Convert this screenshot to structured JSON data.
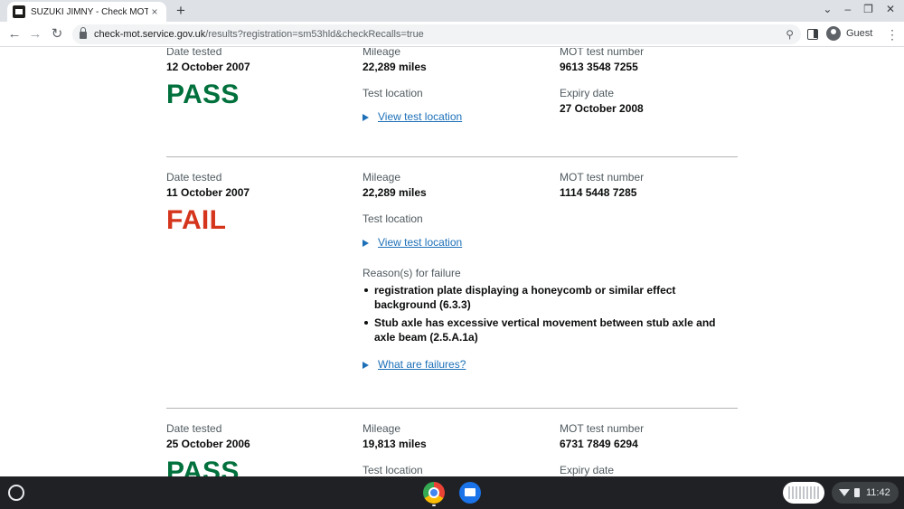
{
  "browser": {
    "tab": {
      "title": "SUZUKI JIMNY - Check MOT history",
      "close": "×"
    },
    "new_tab": "+",
    "window_controls": [
      "⌄",
      "–",
      "❐",
      "✕"
    ],
    "nav": {
      "back": "←",
      "forward": "→",
      "reload": "↻"
    },
    "url": {
      "host": "check-mot.service.gov.uk",
      "path": "/results?registration=sm53hld&checkRecalls=true"
    },
    "zoom": "⚲",
    "profile_label": "Guest",
    "menu": "⋮"
  },
  "labels": {
    "date_tested": "Date tested",
    "mileage": "Mileage",
    "mot_test_number": "MOT test number",
    "test_location": "Test location",
    "expiry_date": "Expiry date",
    "view_test_location": "View test location",
    "reasons_for_failure": "Reason(s) for failure",
    "what_are_failures": "What are failures?"
  },
  "records": [
    {
      "date": "12 October 2007",
      "result": "PASS",
      "mileage": "22,289 miles",
      "test_number": "9613 3548 7255",
      "expiry": "27 October 2008"
    },
    {
      "date": "11 October 2007",
      "result": "FAIL",
      "mileage": "22,289 miles",
      "test_number": "1114 5448 7285",
      "reasons": [
        "registration plate displaying a honeycomb or similar effect background (6.3.3)",
        "Stub axle has excessive vertical movement between stub axle and axle beam (2.5.A.1a)"
      ]
    },
    {
      "date": "25 October 2006",
      "result": "PASS",
      "mileage": "19,813 miles",
      "test_number": "6731 7849 6294"
    }
  ],
  "shelf": {
    "time": "11:42"
  },
  "colors": {
    "pass": "#00703c",
    "fail": "#d4351c",
    "link": "#1d70b8"
  }
}
